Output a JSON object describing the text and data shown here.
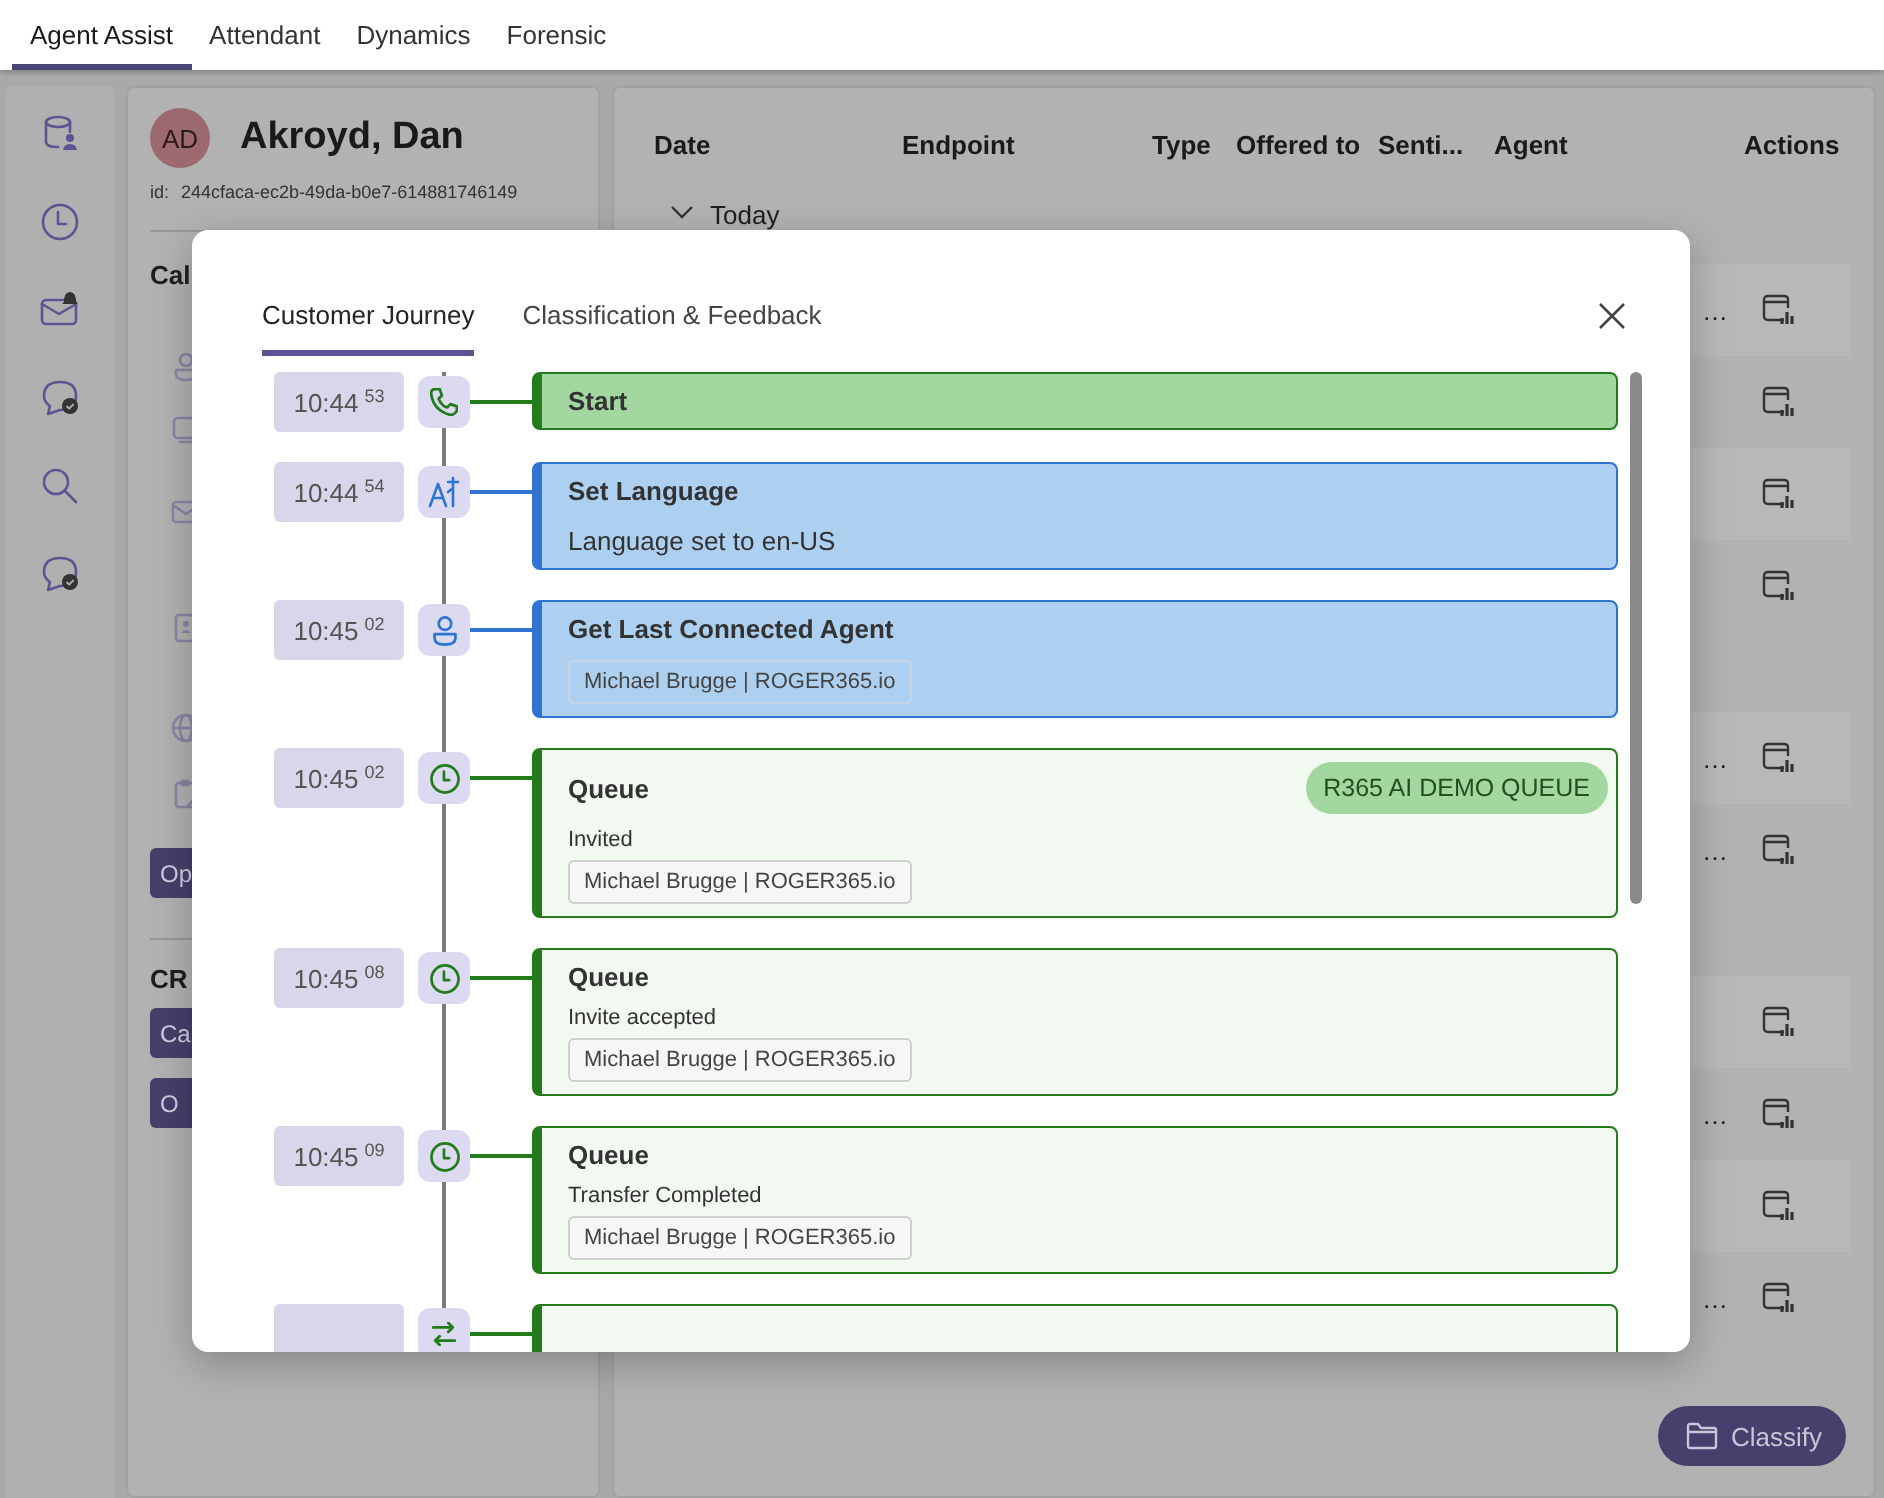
{
  "app_tabs": [
    {
      "label": "Agent Assist",
      "selected": true
    },
    {
      "label": "Attendant",
      "selected": false
    },
    {
      "label": "Dynamics",
      "selected": false
    },
    {
      "label": "Forensic",
      "selected": false
    }
  ],
  "contact": {
    "initials": "AD",
    "name": "Akroyd, Dan",
    "id_label": "id:",
    "id": "244cfaca-ec2b-49da-b0e7-614881746149"
  },
  "left_panel": {
    "section_1_title": "Cal",
    "section_1_button": "Op",
    "section_2_title": "CR",
    "section_2_buttons": [
      "Ca",
      "O"
    ]
  },
  "table": {
    "columns": [
      "Date",
      "Endpoint",
      "Type",
      "Offered to",
      "Senti...",
      "Agent",
      "Actions"
    ],
    "groups": [
      {
        "label": "Today",
        "expanded": true,
        "rows": [
          {
            "agent": "…"
          },
          {},
          {},
          {}
        ]
      },
      {
        "rows": [
          {
            "agent": "…"
          },
          {
            "agent": "…"
          }
        ]
      },
      {
        "rows": [
          {},
          {
            "agent": "…"
          },
          {},
          {
            "agent": "…"
          }
        ]
      }
    ]
  },
  "classify_button": "Classify",
  "dialog": {
    "tabs": [
      {
        "label": "Customer Journey",
        "selected": true
      },
      {
        "label": "Classification & Feedback",
        "selected": false
      }
    ],
    "events": [
      {
        "kind": "start",
        "color": "#237b1c",
        "time": "10:44",
        "seconds": "53",
        "title": "Start"
      },
      {
        "kind": "step",
        "color": "#2f74d0",
        "time": "10:44",
        "seconds": "54",
        "title": "Set Language",
        "detail": "Language set to en-US"
      },
      {
        "kind": "step",
        "color": "#2f74d0",
        "time": "10:45",
        "seconds": "02",
        "title": "Get Last Connected Agent",
        "agent": "Michael Brugge | ROGER365.io"
      },
      {
        "kind": "queue",
        "color": "#237b1c",
        "time": "10:45",
        "seconds": "02",
        "title": "Queue",
        "badge": "R365 AI DEMO QUEUE",
        "note": "Invited",
        "agent": "Michael Brugge | ROGER365.io"
      },
      {
        "kind": "queue",
        "color": "#237b1c",
        "time": "10:45",
        "seconds": "08",
        "title": "Queue",
        "note": "Invite accepted",
        "agent": "Michael Brugge | ROGER365.io"
      },
      {
        "kind": "queue",
        "color": "#237b1c",
        "time": "10:45",
        "seconds": "09",
        "title": "Queue",
        "note": "Transfer Completed",
        "agent": "Michael Brugge | ROGER365.io"
      },
      {
        "kind": "queue",
        "color": "#237b1c"
      }
    ]
  }
}
